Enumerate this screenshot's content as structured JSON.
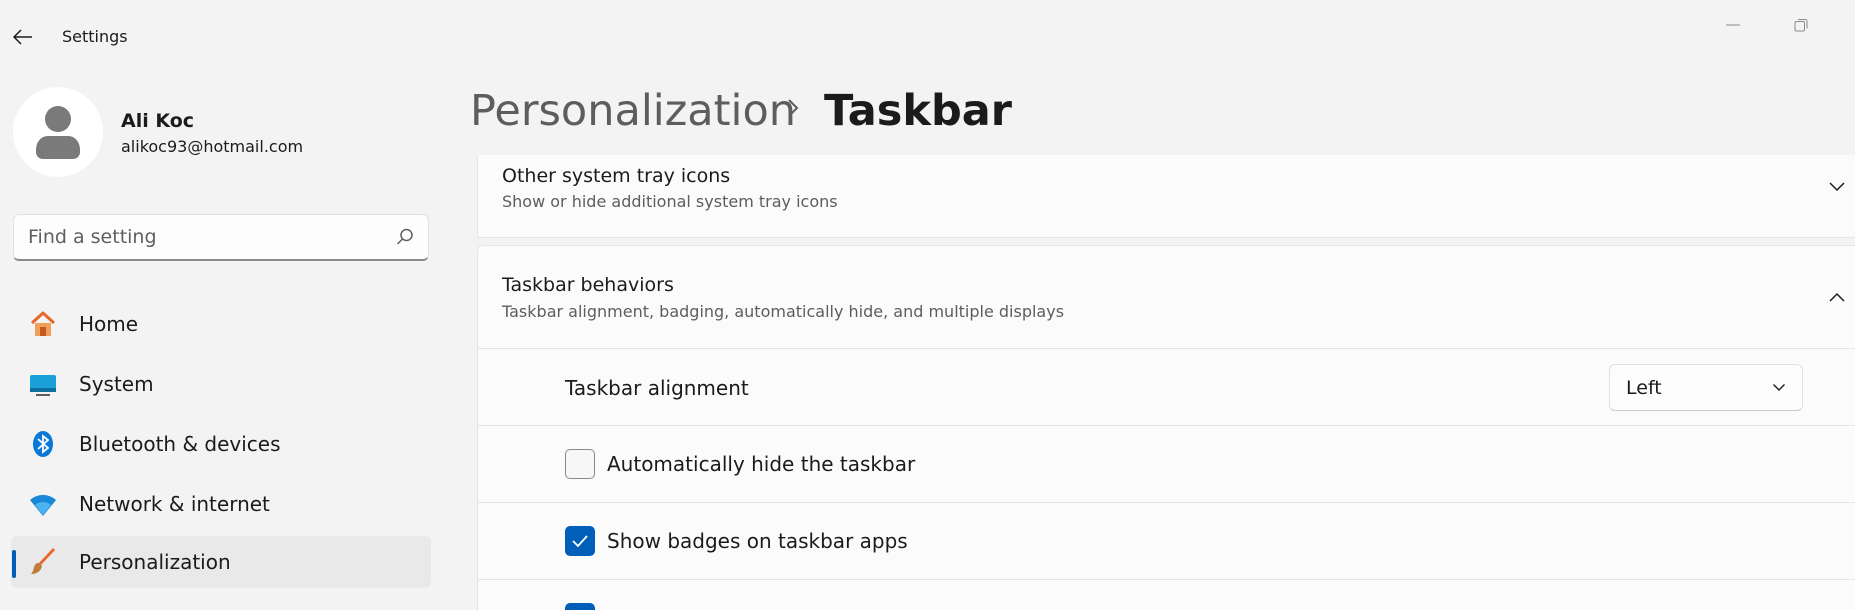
{
  "window": {
    "title": "Settings"
  },
  "profile": {
    "name": "Ali Koc",
    "email": "alikoc93@hotmail.com"
  },
  "search": {
    "placeholder": "Find a setting"
  },
  "nav": {
    "items": [
      {
        "label": "Home",
        "icon": "home-icon"
      },
      {
        "label": "System",
        "icon": "system-icon"
      },
      {
        "label": "Bluetooth & devices",
        "icon": "bluetooth-icon"
      },
      {
        "label": "Network & internet",
        "icon": "wifi-icon"
      },
      {
        "label": "Personalization",
        "icon": "brush-icon",
        "selected": true
      }
    ]
  },
  "breadcrumb": {
    "parent": "Personalization",
    "current": "Taskbar"
  },
  "sections": {
    "tray": {
      "title": "Other system tray icons",
      "subtitle": "Show or hide additional system tray icons"
    },
    "behaviors": {
      "title": "Taskbar behaviors",
      "subtitle": "Taskbar alignment, badging, automatically hide, and multiple displays",
      "alignment": {
        "label": "Taskbar alignment",
        "value": "Left"
      },
      "autohide": {
        "label": "Automatically hide the taskbar",
        "checked": false
      },
      "badges": {
        "label": "Show badges on taskbar apps",
        "checked": true
      }
    }
  },
  "colors": {
    "accent": "#005fb8",
    "background": "#f3f3f3",
    "card": "#fbfbfb"
  }
}
